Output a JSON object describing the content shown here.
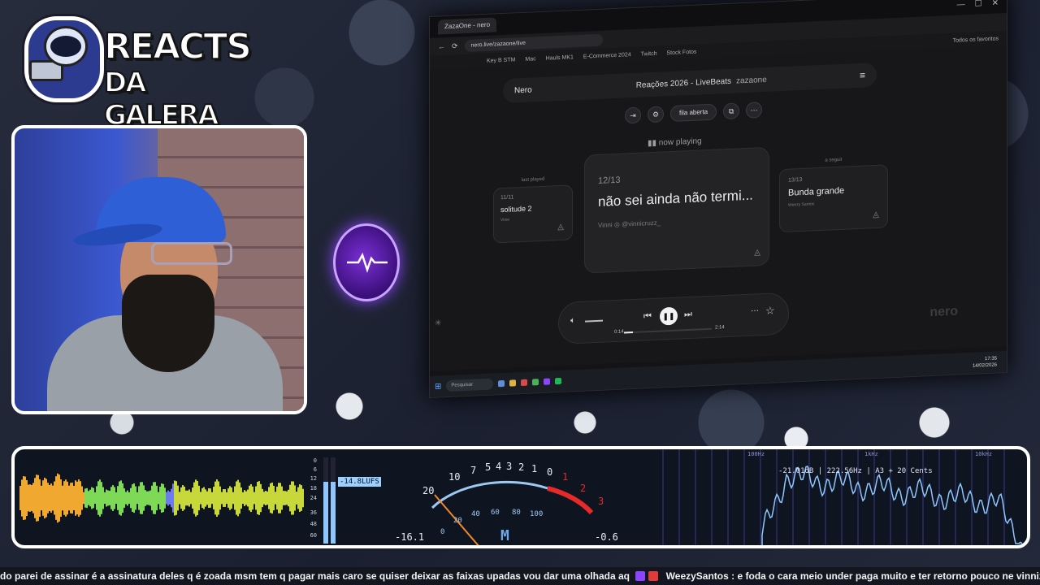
{
  "overlay": {
    "logo_line1": "REACTS",
    "logo_line2": "DA GALERA"
  },
  "browser": {
    "tab_title": "ZazaOne - nero",
    "url": "nero.live/zazaone/live",
    "bookmarks": [
      "Key B STM",
      "Mac",
      "Hauls MK1",
      "E-Commerce 2024",
      "Twitch",
      "Stock Fotos"
    ],
    "bookmarks_all": "Todos os favoritos"
  },
  "app": {
    "brand": "Nero",
    "title": "Reações 2026 - LiveBeats",
    "subtitle": "zazaone",
    "queue_label": "fila aberta",
    "now_playing_label": "now playing",
    "prev_card": {
      "label": "last played",
      "number": "11/11",
      "title": "solitude 2",
      "meta": "Vinie"
    },
    "current_card": {
      "number": "12/13",
      "title": "não sei ainda não termi...",
      "artist": "Vinni",
      "handle": "@vinnicruzz_"
    },
    "next_card": {
      "label": "a seguir",
      "number": "13/13",
      "title": "Bunda grande",
      "meta": "Weezy Santos"
    },
    "player": {
      "elapsed": "0:14",
      "duration": "2:14",
      "progress_fraction": 0.1
    },
    "watermark": "nero"
  },
  "taskbar": {
    "search": "Pesquisar",
    "time": "17:35",
    "date": "14/02/2026"
  },
  "visualizer": {
    "lufs_ticks": [
      "0",
      "6",
      "12",
      "18",
      "24",
      "36",
      "48",
      "60"
    ],
    "lufs_readout": "-14.8LUFS",
    "lufs_level_fraction": 0.72,
    "vu_scale_top": [
      "20",
      "10",
      "7",
      "5",
      "4",
      "3",
      "2",
      "1",
      "0",
      "1",
      "2",
      "3"
    ],
    "vu_scale_bottom": [
      "0",
      "20",
      "40",
      "60",
      "80",
      "100"
    ],
    "vu_left_value": "-16.1",
    "vu_right_value": "-0.6",
    "vu_mode": "M",
    "spectrum_hz": [
      "100Hz",
      "1kHz",
      "10kHz"
    ],
    "spectrum_readout": "-21.01dB | 222.56Hz | A3  + 20 Cents"
  },
  "ticker": {
    "text1": "do parei de assinar  é a assinatura deles q é zoada msm  tem q pagar mais caro se quiser deixar as faixas upadas  vou dar uma olhada aq",
    "user": "WeezySantos",
    "text2": ": e foda o cara meio under paga muito e ter retorno pouco ne vinniz"
  },
  "colors": {
    "accent_purple": "#8b45ff",
    "vu_red": "#e62a2a",
    "spectrum_blue": "#8ec7ff"
  }
}
